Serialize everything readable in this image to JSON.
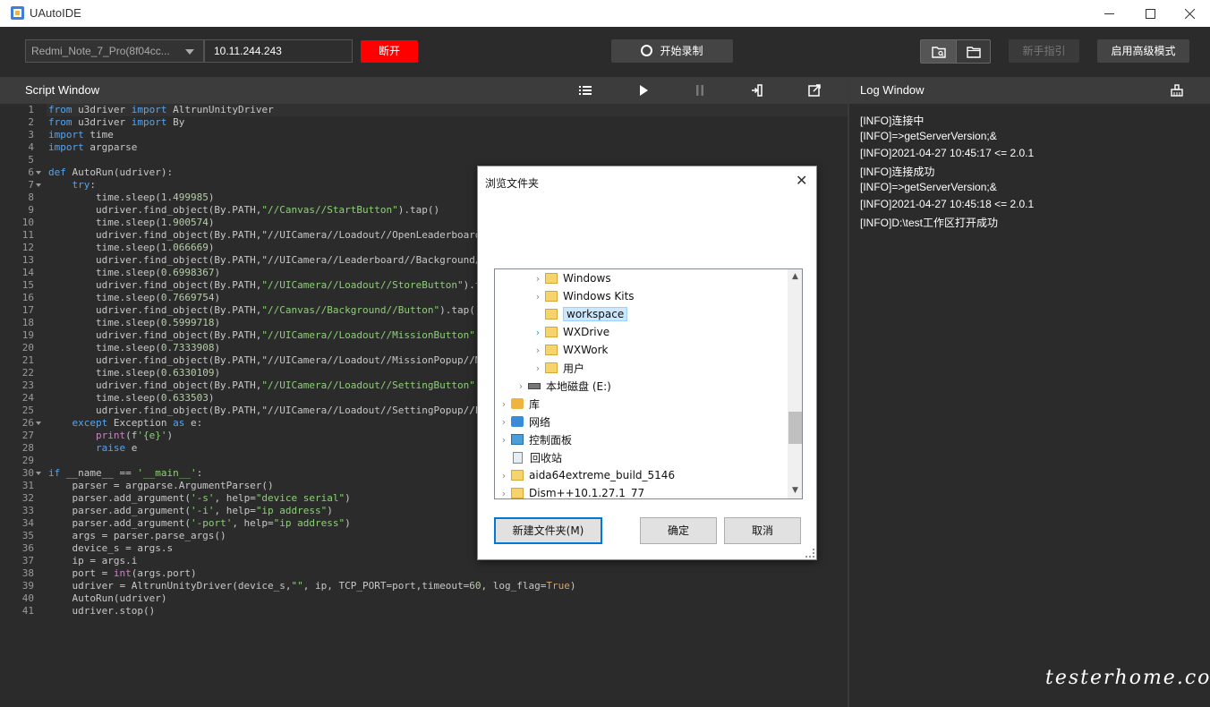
{
  "window": {
    "title": "UAutoIDE"
  },
  "toolbar": {
    "device": "Redmi_Note_7_Pro(8f04cc...",
    "ip": "10.11.244.243",
    "disconnect": "断开",
    "record": "开始录制",
    "guide": "新手指引",
    "advanced": "启用高级模式"
  },
  "script_window": {
    "title": "Script Window"
  },
  "log_window": {
    "title": "Log Window",
    "lines": [
      "[INFO]连接中",
      "[INFO]=>getServerVersion;&",
      "[INFO]2021-04-27 10:45:17 <= 2.0.1",
      "[INFO]连接成功",
      "[INFO]=>getServerVersion;&",
      "[INFO]2021-04-27 10:45:18 <= 2.0.1",
      "[INFO]D:\\test工作区打开成功"
    ]
  },
  "code": {
    "line_numbers": [
      "1",
      "2",
      "3",
      "4",
      "5",
      "6",
      "7",
      "8",
      "9",
      "10",
      "11",
      "12",
      "13",
      "14",
      "15",
      "16",
      "17",
      "18",
      "19",
      "20",
      "21",
      "22",
      "23",
      "24",
      "25",
      "26",
      "27",
      "28",
      "29",
      "30",
      "31",
      "32",
      "33",
      "34",
      "35",
      "36",
      "37",
      "38",
      "39",
      "40",
      "41"
    ],
    "lines": [
      "from u3driver import AltrunUnityDriver",
      "from u3driver import By",
      "import time",
      "import argparse",
      "",
      "def AutoRun(udriver):",
      "    try:",
      "        time.sleep(1.499985)",
      "        udriver.find_object(By.PATH,\"//Canvas//StartButton\").tap()",
      "        time.sleep(1.900574)",
      "        udriver.find_object(By.PATH,\"//UICamera//Loadout//OpenLeaderboard",
      "        time.sleep(1.066669)",
      "        udriver.find_object(By.PATH,\"//UICamera//Leaderboard//Background/",
      "        time.sleep(0.6998367)",
      "        udriver.find_object(By.PATH,\"//UICamera//Loadout//StoreButton\").t",
      "        time.sleep(0.7669754)",
      "        udriver.find_object(By.PATH,\"//Canvas//Background//Button\").tap()",
      "        time.sleep(0.5999718)",
      "        udriver.find_object(By.PATH,\"//UICamera//Loadout//MissionButton\")",
      "        time.sleep(0.7333908)",
      "        udriver.find_object(By.PATH,\"//UICamera//Loadout//MissionPopup//M",
      "        time.sleep(0.6330109)",
      "        udriver.find_object(By.PATH,\"//UICamera//Loadout//SettingButton\")",
      "        time.sleep(0.633503)",
      "        udriver.find_object(By.PATH,\"//UICamera//Loadout//SettingPopup//E",
      "    except Exception as e:",
      "        print(f'{e}')",
      "        raise e",
      "",
      "if __name__ == '__main__':",
      "    parser = argparse.ArgumentParser()",
      "    parser.add_argument('-s', help=\"device serial\")",
      "    parser.add_argument('-i', help=\"ip address\")",
      "    parser.add_argument('-port', help=\"ip address\")",
      "    args = parser.parse_args()",
      "    device_s = args.s",
      "    ip = args.i",
      "    port = int(args.port)",
      "    udriver = AltrunUnityDriver(device_s,\"\", ip, TCP_PORT=port,timeout=60, log_flag=True)",
      "    AutoRun(udriver)",
      "    udriver.stop()"
    ]
  },
  "dialog": {
    "title": "浏览文件夹",
    "close": "✕",
    "tree": [
      {
        "label": "Windows",
        "icon": "folder-icon",
        "level": 2,
        "arrow": "›"
      },
      {
        "label": "Windows Kits",
        "icon": "folder-icon",
        "level": 2,
        "arrow": "›"
      },
      {
        "label": "workspace",
        "icon": "folder-icon",
        "level": 2,
        "arrow": "",
        "selected": true
      },
      {
        "label": "WXDrive",
        "icon": "folder-icon",
        "level": 2,
        "arrow": "›",
        "cyan": true
      },
      {
        "label": "WXWork",
        "icon": "folder-icon",
        "level": 2,
        "arrow": "›"
      },
      {
        "label": "用户",
        "icon": "folder-icon",
        "level": 2,
        "arrow": "›"
      },
      {
        "label": "本地磁盘 (E:)",
        "icon": "drive-icon",
        "level": 1,
        "arrow": "›"
      },
      {
        "label": "库",
        "icon": "library-icon",
        "level": 0,
        "arrow": "›"
      },
      {
        "label": "网络",
        "icon": "network-icon",
        "level": 0,
        "arrow": "›"
      },
      {
        "label": "控制面板",
        "icon": "control-panel-icon",
        "level": 0,
        "arrow": "›"
      },
      {
        "label": "回收站",
        "icon": "recycle-bin-icon",
        "level": 0,
        "arrow": ""
      },
      {
        "label": "aida64extreme_build_5146",
        "icon": "folder-icon",
        "level": 0,
        "arrow": "›"
      },
      {
        "label": "Dism++10.1.27.1_77",
        "icon": "folder-icon",
        "level": 0,
        "arrow": "›"
      }
    ],
    "buttons": {
      "new_folder": "新建文件夹(M)",
      "ok": "确定",
      "cancel": "取消"
    }
  },
  "watermark": "testerhome.com"
}
